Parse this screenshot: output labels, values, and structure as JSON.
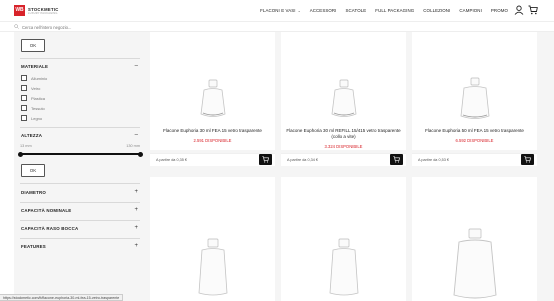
{
  "header": {
    "logo_mark": "WB",
    "logo_name": "STOCKMETIC",
    "logo_tagline": "LUXURY PACKAGING",
    "nav": [
      {
        "label": "FLACONI E VASI",
        "dropdown": true
      },
      {
        "label": "ACCESSORI"
      },
      {
        "label": "SCATOLE"
      },
      {
        "label": "FULL PACKAGING"
      },
      {
        "label": "COLLEZIONI"
      },
      {
        "label": "CAMPIONI"
      },
      {
        "label": "PROMO"
      }
    ],
    "icons": [
      "user-icon",
      "cart-icon"
    ]
  },
  "search": {
    "placeholder": "Cerca nell'intero negozio..."
  },
  "sidebar": {
    "ok_label": "OK",
    "materiale": {
      "title": "MATERIALE",
      "toggle": "–",
      "options": [
        "Alluminio",
        "Vetro",
        "Plastica",
        "Tessuto",
        "Legno"
      ]
    },
    "altezza": {
      "title": "ALTEZZA",
      "toggle": "–",
      "min_label": "13 mm",
      "max_label": "130 mm",
      "range_min": 0,
      "range_max": 1,
      "ok_label": "OK"
    },
    "collapsed": [
      {
        "title": "DIAMETRO",
        "toggle": "+"
      },
      {
        "title": "CAPACITÀ NOMINALE",
        "toggle": "+"
      },
      {
        "title": "CAPACITÀ RASO BOCCA",
        "toggle": "+"
      },
      {
        "title": "FEATURES",
        "toggle": "+"
      }
    ]
  },
  "products": [
    {
      "title": "Flacone Euphoria 30 ml FEA 15 vetro trasparente",
      "availability": "2.591 DISPONIBILE",
      "price": "A partire da 0,35 €"
    },
    {
      "title": "Flacone Euphoria 30 ml REFILL 15/415 vetro trasparente (collo a vite)",
      "availability": "3.324 DISPONIBILE",
      "price": "A partire da 0,34 €"
    },
    {
      "title": "Flacone Euphoria 50 ml FEA 15 vetro trasparente",
      "availability": "6.592 DISPONIBILE",
      "price": "A partire da 0,53 €"
    }
  ],
  "status_bar": "https://stockmetic.com/it/flacone-euphoria-30-ml-fea-15-vetro-trasparente",
  "colors": {
    "accent": "#d8232a",
    "dark": "#111111",
    "panel": "#f5f5f5"
  }
}
